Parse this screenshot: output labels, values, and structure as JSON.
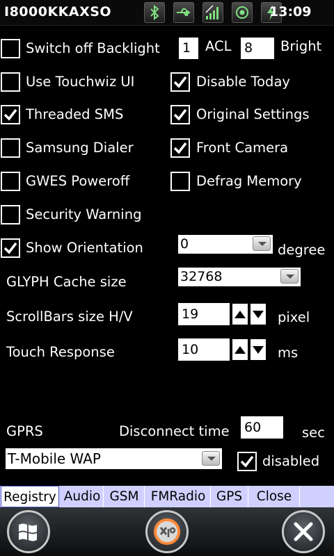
{
  "status": {
    "device_name": "I8000KKAXSO",
    "time": "13:09",
    "icons": [
      "bluetooth-icon",
      "usb-icon",
      "signal-icon",
      "camera-icon",
      "battery-charging-icon"
    ]
  },
  "options_left": [
    {
      "label": "Switch off Backlight",
      "checked": false
    },
    {
      "label": "Use Touchwiz UI",
      "checked": false
    },
    {
      "label": "Threaded SMS",
      "checked": true
    },
    {
      "label": "Samsung Dialer",
      "checked": false
    },
    {
      "label": "GWES Poweroff",
      "checked": false
    },
    {
      "label": "Security Warning",
      "checked": false
    },
    {
      "label": "Show Orientation",
      "checked": true
    }
  ],
  "options_right": [
    {
      "label": "Disable Today",
      "checked": true
    },
    {
      "label": "Original Settings",
      "checked": true
    },
    {
      "label": "Front Camera",
      "checked": true
    },
    {
      "label": "Defrag Memory",
      "checked": false
    }
  ],
  "backlight": {
    "acl_value": "1",
    "acl_label": "ACL",
    "bright_value": "8",
    "bright_label": "Bright"
  },
  "orientation": {
    "value": "0",
    "unit": "degree"
  },
  "glyph_cache": {
    "label": "GLYPH Cache size",
    "value": "32768"
  },
  "scrollbars": {
    "label": "ScrollBars size H/V",
    "value": "19",
    "unit": "pixel"
  },
  "touch_response": {
    "label": "Touch Response",
    "value": "10",
    "unit": "ms"
  },
  "gprs": {
    "label": "GPRS",
    "disconnect_label": "Disconnect time",
    "disconnect_value": "60",
    "disconnect_unit": "sec",
    "connection": "T-Mobile WAP",
    "disabled_label": "disabled",
    "disabled_checked": true
  },
  "tabs": [
    {
      "label": "Registry",
      "active": true
    },
    {
      "label": "Audio",
      "active": false
    },
    {
      "label": "GSM",
      "active": false
    },
    {
      "label": "FMRadio",
      "active": false
    },
    {
      "label": "GPS",
      "active": false
    },
    {
      "label": "Close",
      "active": false
    }
  ],
  "bottom": {
    "start_icon": "windows-start-icon",
    "app_icon": "x19-app-icon",
    "close_icon": "close-icon"
  }
}
